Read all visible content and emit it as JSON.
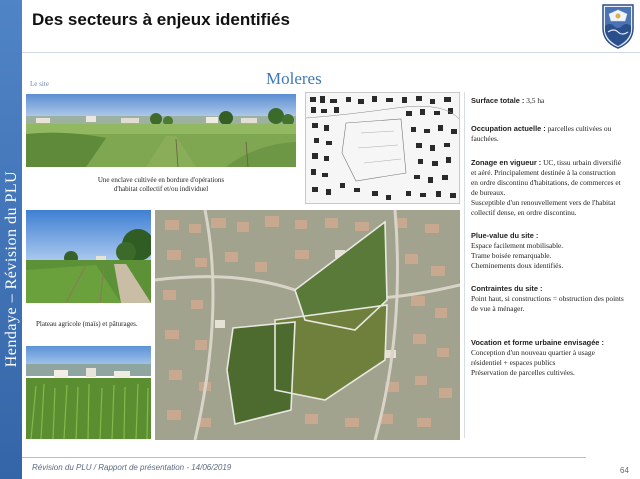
{
  "slide": {
    "title": "Des secteurs à enjeux identifiés",
    "side_label": "Hendaye – Révision du PLU",
    "section_label": "Le site",
    "site_name": "Moleres",
    "footer": "Révision du PLU / Rapport de présentation - 14/06/2019",
    "page_number": "64"
  },
  "captions": {
    "landscape": [
      "Une enclave cultivée en bordure d'opérations",
      "d'habitat collectif et/ou individuel"
    ],
    "plateau": "Plateau agricole (maïs) et pâturages."
  },
  "info": {
    "surface": {
      "label": "Surface totale :",
      "value": "3,5 ha"
    },
    "occupation": {
      "label": "Occupation actuelle :",
      "value": "parcelles cultivées ou fauchées."
    },
    "zonage": {
      "label": "Zonage en vigueur :",
      "value": "UC, tissu urbain diversifié et aéré. Principalement destinée à la construction en ordre discontinu d'habitations, de commerces et de bureaux.",
      "extra": "Susceptible d'un renouvellement vers de l'habitat collectif dense, en ordre discontinu."
    },
    "plus_value": {
      "label": "Plue-value du site :",
      "lines": [
        "Espace facilement mobilisable.",
        "Trame boisée remarquable.",
        "Cheminements doux identifiés."
      ]
    },
    "contraintes": {
      "label": "Contraintes du site :",
      "value": "Point haut, si constructions = obstruction des points de vue à ménager."
    },
    "vocation": {
      "label": "Vocation et forme urbaine envisagée :",
      "lines": [
        "Conception d'un nouveau quartier à usage résidentiel + espaces publics",
        "Préservation de parcelles cultivées."
      ]
    }
  },
  "colors": {
    "band": "#3f72b5",
    "site_title": "#3f78b8",
    "field_highlight": "#4e6b2f"
  },
  "icons": {
    "logo": "hendaye-coat-of-arms-icon"
  }
}
